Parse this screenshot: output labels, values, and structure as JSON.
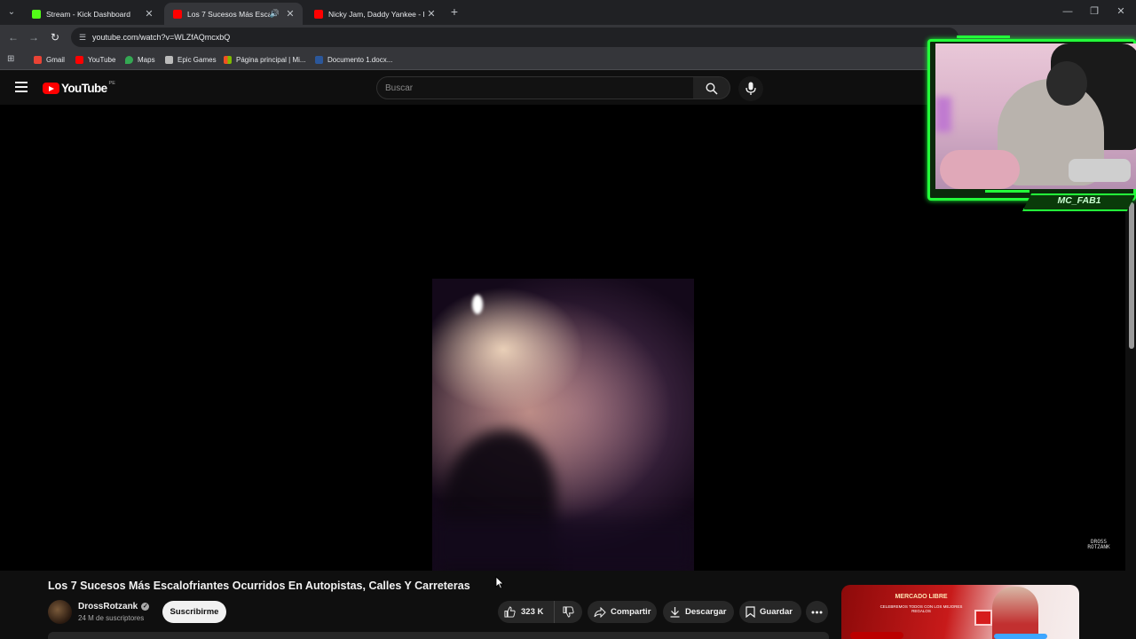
{
  "browser": {
    "tabs": [
      {
        "title": "Stream - Kick Dashboard",
        "active": false
      },
      {
        "title": "Los 7 Sucesos Más Escalofri",
        "active": true
      },
      {
        "title": "Nicky Jam, Daddy Yankee - Do",
        "active": false
      }
    ],
    "url": "youtube.com/watch?v=WLZfAQmcxbQ",
    "bookmarks": [
      "Gmail",
      "YouTube",
      "Maps",
      "Epic Games",
      "Página principal | Mi...",
      "Documento 1.docx..."
    ]
  },
  "youtube": {
    "logo_text": "YouTube",
    "country_code": "PE",
    "search_placeholder": "Buscar",
    "watermark_text": "DROSS ROTZANK",
    "video": {
      "title": "Los 7 Sucesos Más Escalofriantes Ocurridos En Autopistas, Calles Y Carreteras",
      "channel": "DrossRotzank",
      "subscribers": "24 M de suscriptores",
      "subscribe_label": "Suscribirme",
      "likes": "323 K",
      "share_label": "Compartir",
      "download_label": "Descargar",
      "save_label": "Guardar"
    },
    "ad": {
      "headline": "MERCADO LIBRE",
      "subline": "CELEBREMOS TODOS CON LOS MEJORES REGALOS"
    }
  },
  "overlay": {
    "streamer_name": "MC_FAB1",
    "accent_color": "#23ff3a"
  },
  "colors": {
    "youtube_red": "#ff0000",
    "background": "#0f0f0f",
    "chrome_dark": "#202124",
    "chrome_toolbar": "#35363a"
  }
}
